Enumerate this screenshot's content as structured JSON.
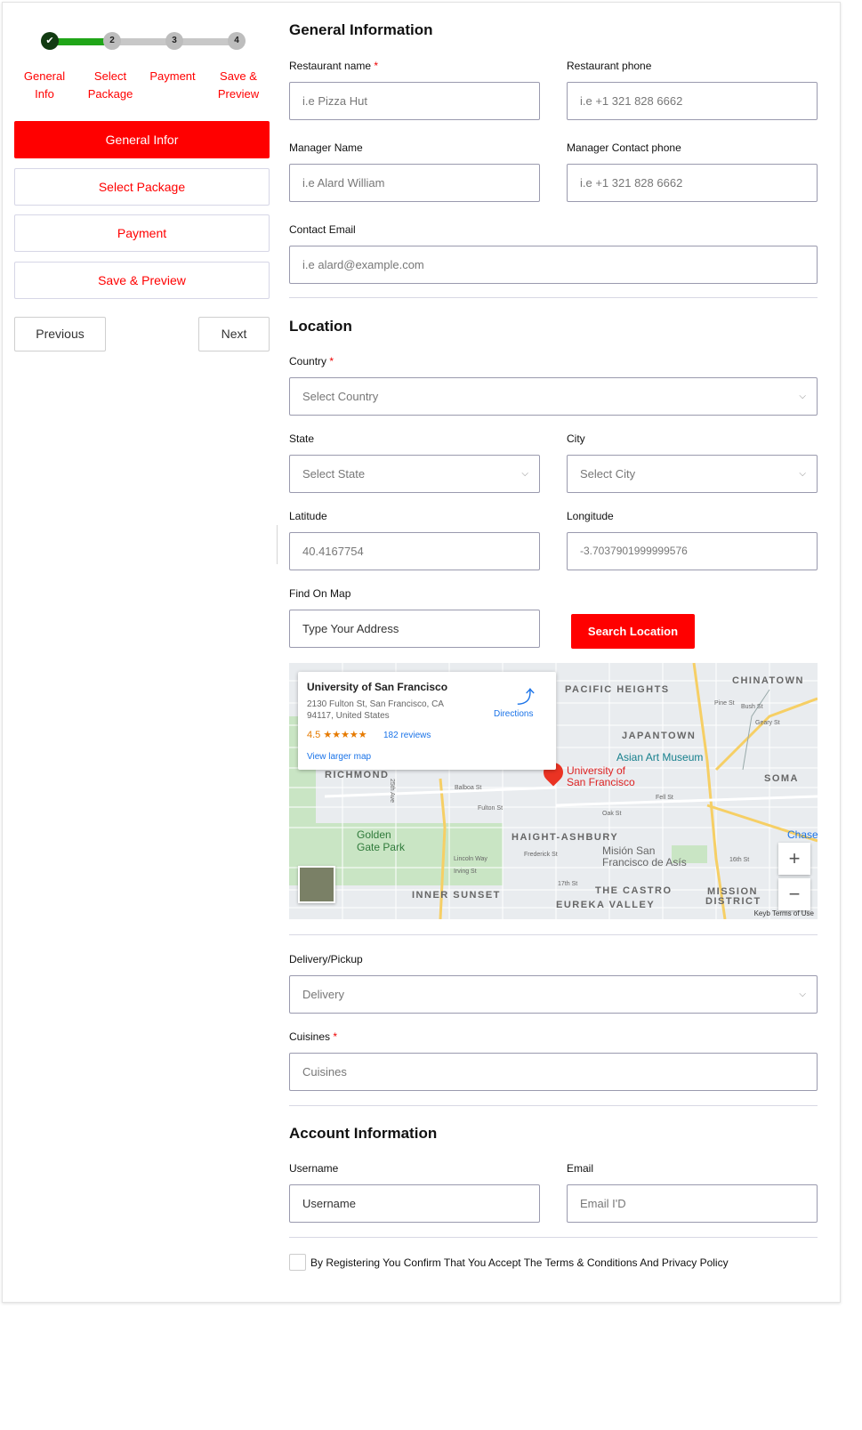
{
  "stepper": {
    "steps": [
      {
        "number": "✔",
        "label": "General Info"
      },
      {
        "number": "2",
        "label": "Select Package"
      },
      {
        "number": "3",
        "label": "Payment"
      },
      {
        "number": "4",
        "label": "Save & Preview"
      }
    ],
    "label_lines": [
      [
        "General",
        "Info"
      ],
      [
        "Select",
        "Package"
      ],
      [
        "Payment",
        ""
      ],
      [
        "Save &",
        "Preview"
      ]
    ]
  },
  "sidebar": {
    "items": [
      "General Infor",
      "Select Package",
      "Payment",
      "Save & Preview"
    ],
    "previous_label": "Previous",
    "next_label": "Next"
  },
  "general": {
    "heading": "General Information",
    "restaurant_name_label": "Restaurant name",
    "restaurant_name_placeholder": "i.e Pizza Hut",
    "restaurant_phone_label": "Restaurant phone",
    "restaurant_phone_placeholder": "i.e +1 321 828 6662",
    "manager_name_label": "Manager Name",
    "manager_name_placeholder": "i.e Alard William",
    "manager_phone_label": "Manager Contact phone",
    "manager_phone_placeholder": "i.e +1 321 828 6662",
    "email_label": "Contact Email",
    "email_placeholder": "i.e alard@example.com"
  },
  "location": {
    "heading": "Location",
    "country_label": "Country",
    "country_value": "Select Country",
    "state_label": "State",
    "state_value": "Select State",
    "city_label": "City",
    "city_value": "Select City",
    "latitude_label": "Latitude",
    "latitude_value": "40.4167754",
    "longitude_label": "Longitude",
    "longitude_value": "-3.7037901999999576",
    "find_label": "Find On Map",
    "find_placeholder": "Type Your Address",
    "search_label": "Search Location"
  },
  "map": {
    "place_title": "University of San Francisco",
    "address_line1": "2130 Fulton St, San Francisco, CA",
    "address_line2": "94117, United States",
    "rating": "4.5 ★★★★★",
    "reviews": "182 reviews",
    "view_larger": "View larger map",
    "directions": "Directions",
    "marker_label_1": "University of",
    "marker_label_2": "San Francisco",
    "areas": [
      "PACIFIC HEIGHTS",
      "CHINATOWN",
      "JAPANTOWN",
      "RICHMOND",
      "SOMA",
      "HAIGHT-ASHBURY",
      "INNER SUNSET",
      "THE CASTRO",
      "EUREKA VALLEY",
      "MISSION",
      "DISTRICT"
    ],
    "parks": [
      "Golden",
      "Gate Park"
    ],
    "pois": [
      "Asian Art Museum",
      "Misión San",
      "Francisco de Asís",
      "Chase"
    ],
    "streets": [
      "Balboa St",
      "Fulton St",
      "Lincoln Way",
      "Irving St",
      "Fell St",
      "Oak St",
      "Frederick St",
      "17th St",
      "16th St",
      "Bush St",
      "Pine St",
      "Geary St",
      "25th Ave"
    ],
    "terms": "Keyb Terms of Use",
    "zoom_in": "+",
    "zoom_out": "−"
  },
  "delivery": {
    "label": "Delivery/Pickup",
    "value": "Delivery",
    "cuisines_label": "Cuisines",
    "cuisines_placeholder": "Cuisines"
  },
  "account": {
    "heading": "Account Information",
    "username_label": "Username",
    "username_placeholder": "Username",
    "email_label": "Email",
    "email_placeholder": "Email I'D",
    "terms_text": "By Registering You Confirm That You Accept The Terms & Conditions And Privacy Policy"
  },
  "colors": {
    "accent": "#ff0000",
    "progress": "#20a518",
    "done_dot": "#123b12"
  }
}
